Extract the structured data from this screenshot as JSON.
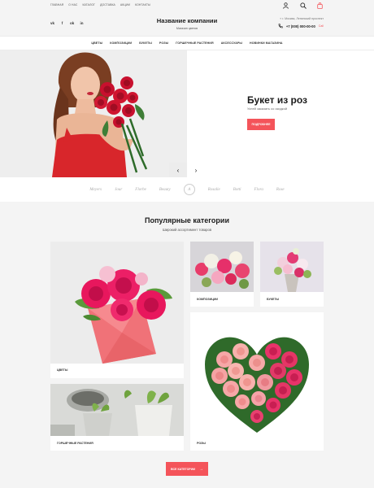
{
  "topnav": [
    "Главная",
    "О нас",
    "Каталог",
    "Доставка",
    "Акции",
    "Контакты"
  ],
  "header": {
    "company_name": "Название компании",
    "company_sub": "Магазин цветов",
    "address": "г. Москва, Ленинский проспект",
    "phone": "+7 (000) 000-00-00",
    "call_label": "Call"
  },
  "socials": [
    "vk",
    "f",
    "ok",
    "in"
  ],
  "mainnav": [
    "Цветы",
    "Композиции",
    "Букеты",
    "Розы",
    "Горшечные растения",
    "Аксессуары",
    "Новинки магазина"
  ],
  "hero": {
    "title": "Букет из роз",
    "subtitle": "Успей заказать со скидкой",
    "button": "Подробнее",
    "prev": "‹",
    "next": "›"
  },
  "brands": [
    "Meyers",
    "Jour",
    "Florbe",
    "Beauty",
    "A",
    "Rosalie",
    "Botti",
    "Flora",
    "Rose"
  ],
  "categories": {
    "title": "Популярные категории",
    "subtitle": "Широкий ассортимент товаров",
    "items": [
      {
        "label": "Цветы"
      },
      {
        "label": "Композиции"
      },
      {
        "label": "Букеты"
      },
      {
        "label": "Горшечные растения"
      },
      {
        "label": "Розы"
      }
    ],
    "more_button": "Все категории"
  },
  "colors": {
    "accent": "#f4545a",
    "background": "#f4f4f4"
  }
}
